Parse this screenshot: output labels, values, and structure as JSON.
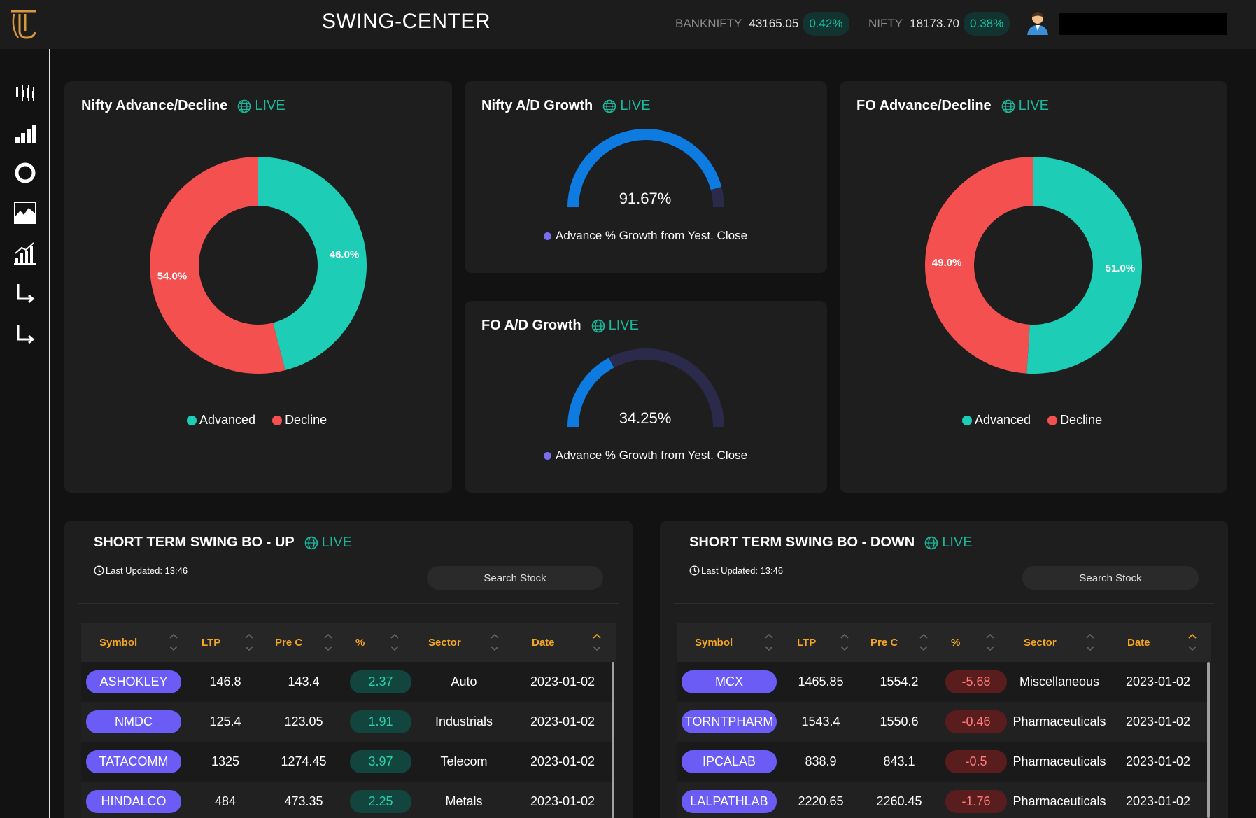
{
  "header": {
    "title": "SWING-CENTER",
    "tickers": [
      {
        "name": "BANKNIFTY",
        "value": "43165.05",
        "change": "0.42%"
      },
      {
        "name": "NIFTY",
        "value": "18173.70",
        "change": "0.38%"
      }
    ]
  },
  "sidebar": {
    "icons": [
      "candlestick-icon",
      "bar-chart-icon",
      "donut-icon",
      "area-chart-icon",
      "growth-chart-icon",
      "corner-arrow-icon",
      "corner-arrow-icon"
    ]
  },
  "colors": {
    "advanced": "#1ecdb5",
    "decline": "#f4504f",
    "gauge": "#0d7be0",
    "gauge_track": "#2c2a4a",
    "live": "#1ab99c",
    "pill": "#6a5cf5",
    "header_text": "#f5a623"
  },
  "cards": {
    "nifty_ad": {
      "title": "Nifty Advance/Decline",
      "live": "LIVE"
    },
    "nifty_growth": {
      "title": "Nifty A/D Growth",
      "live": "LIVE",
      "value": "91.67%",
      "legend": "Advance % Growth from Yest. Close"
    },
    "fo_growth": {
      "title": "FO A/D Growth",
      "live": "LIVE",
      "value": "34.25%",
      "legend": "Advance % Growth from Yest. Close"
    },
    "fo_ad": {
      "title": "FO Advance/Decline",
      "live": "LIVE"
    }
  },
  "chart_data": [
    {
      "type": "pie",
      "categories": [
        "Advanced",
        "Decline"
      ],
      "values": [
        46.0,
        54.0
      ],
      "labels": [
        "46.0%",
        "54.0%"
      ]
    },
    {
      "type": "gauge",
      "value": 91.67,
      "label": "91.67%",
      "series": [
        {
          "name": "Advance % Growth from Yest. Close",
          "values": [
            91.67
          ]
        }
      ]
    },
    {
      "type": "gauge",
      "value": 34.25,
      "label": "34.25%",
      "series": [
        {
          "name": "Advance % Growth from Yest. Close",
          "values": [
            34.25
          ]
        }
      ]
    },
    {
      "type": "pie",
      "categories": [
        "Advanced",
        "Decline"
      ],
      "values": [
        51.0,
        49.0
      ],
      "labels": [
        "51.0%",
        "49.0%"
      ]
    }
  ],
  "legend": {
    "advanced": "Advanced",
    "decline": "Decline"
  },
  "tables": {
    "up": {
      "title": "SHORT TERM SWING BO - UP",
      "live": "LIVE",
      "last_updated": "Last Updated: 13:46",
      "search_placeholder": "Search Stock",
      "columns": [
        "Symbol",
        "LTP",
        "Pre C",
        "%",
        "Sector",
        "Date"
      ],
      "rows": [
        {
          "symbol": "ASHOKLEY",
          "ltp": "146.8",
          "prec": "143.4",
          "pct": "2.37",
          "sector": "Auto",
          "date": "2023-01-02"
        },
        {
          "symbol": "NMDC",
          "ltp": "125.4",
          "prec": "123.05",
          "pct": "1.91",
          "sector": "Industrials",
          "date": "2023-01-02"
        },
        {
          "symbol": "TATACOMM",
          "ltp": "1325",
          "prec": "1274.45",
          "pct": "3.97",
          "sector": "Telecom",
          "date": "2023-01-02"
        },
        {
          "symbol": "HINDALCO",
          "ltp": "484",
          "prec": "473.35",
          "pct": "2.25",
          "sector": "Metals",
          "date": "2023-01-02"
        }
      ]
    },
    "down": {
      "title": "SHORT TERM SWING BO - DOWN",
      "live": "LIVE",
      "last_updated": "Last Updated: 13:46",
      "search_placeholder": "Search Stock",
      "columns": [
        "Symbol",
        "LTP",
        "Pre C",
        "%",
        "Sector",
        "Date"
      ],
      "rows": [
        {
          "symbol": "MCX",
          "ltp": "1465.85",
          "prec": "1554.2",
          "pct": "-5.68",
          "sector": "Miscellaneous",
          "date": "2023-01-02"
        },
        {
          "symbol": "TORNTPHARM",
          "ltp": "1543.4",
          "prec": "1550.6",
          "pct": "-0.46",
          "sector": "Pharmaceuticals",
          "date": "2023-01-02"
        },
        {
          "symbol": "IPCALAB",
          "ltp": "838.9",
          "prec": "843.1",
          "pct": "-0.5",
          "sector": "Pharmaceuticals",
          "date": "2023-01-02"
        },
        {
          "symbol": "LALPATHLAB",
          "ltp": "2220.65",
          "prec": "2260.45",
          "pct": "-1.76",
          "sector": "Pharmaceuticals",
          "date": "2023-01-02"
        }
      ]
    }
  }
}
